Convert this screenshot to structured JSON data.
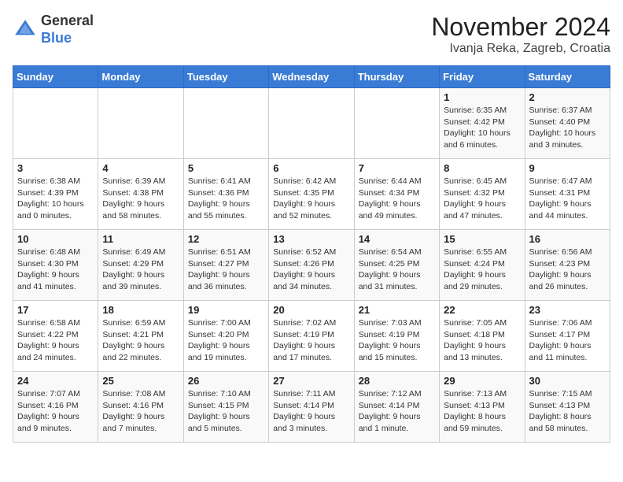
{
  "header": {
    "logo_general": "General",
    "logo_blue": "Blue",
    "month_title": "November 2024",
    "location": "Ivanja Reka, Zagreb, Croatia"
  },
  "calendar": {
    "days_of_week": [
      "Sunday",
      "Monday",
      "Tuesday",
      "Wednesday",
      "Thursday",
      "Friday",
      "Saturday"
    ],
    "weeks": [
      [
        {
          "day": "",
          "info": ""
        },
        {
          "day": "",
          "info": ""
        },
        {
          "day": "",
          "info": ""
        },
        {
          "day": "",
          "info": ""
        },
        {
          "day": "",
          "info": ""
        },
        {
          "day": "1",
          "info": "Sunrise: 6:35 AM\nSunset: 4:42 PM\nDaylight: 10 hours and 6 minutes."
        },
        {
          "day": "2",
          "info": "Sunrise: 6:37 AM\nSunset: 4:40 PM\nDaylight: 10 hours and 3 minutes."
        }
      ],
      [
        {
          "day": "3",
          "info": "Sunrise: 6:38 AM\nSunset: 4:39 PM\nDaylight: 10 hours and 0 minutes."
        },
        {
          "day": "4",
          "info": "Sunrise: 6:39 AM\nSunset: 4:38 PM\nDaylight: 9 hours and 58 minutes."
        },
        {
          "day": "5",
          "info": "Sunrise: 6:41 AM\nSunset: 4:36 PM\nDaylight: 9 hours and 55 minutes."
        },
        {
          "day": "6",
          "info": "Sunrise: 6:42 AM\nSunset: 4:35 PM\nDaylight: 9 hours and 52 minutes."
        },
        {
          "day": "7",
          "info": "Sunrise: 6:44 AM\nSunset: 4:34 PM\nDaylight: 9 hours and 49 minutes."
        },
        {
          "day": "8",
          "info": "Sunrise: 6:45 AM\nSunset: 4:32 PM\nDaylight: 9 hours and 47 minutes."
        },
        {
          "day": "9",
          "info": "Sunrise: 6:47 AM\nSunset: 4:31 PM\nDaylight: 9 hours and 44 minutes."
        }
      ],
      [
        {
          "day": "10",
          "info": "Sunrise: 6:48 AM\nSunset: 4:30 PM\nDaylight: 9 hours and 41 minutes."
        },
        {
          "day": "11",
          "info": "Sunrise: 6:49 AM\nSunset: 4:29 PM\nDaylight: 9 hours and 39 minutes."
        },
        {
          "day": "12",
          "info": "Sunrise: 6:51 AM\nSunset: 4:27 PM\nDaylight: 9 hours and 36 minutes."
        },
        {
          "day": "13",
          "info": "Sunrise: 6:52 AM\nSunset: 4:26 PM\nDaylight: 9 hours and 34 minutes."
        },
        {
          "day": "14",
          "info": "Sunrise: 6:54 AM\nSunset: 4:25 PM\nDaylight: 9 hours and 31 minutes."
        },
        {
          "day": "15",
          "info": "Sunrise: 6:55 AM\nSunset: 4:24 PM\nDaylight: 9 hours and 29 minutes."
        },
        {
          "day": "16",
          "info": "Sunrise: 6:56 AM\nSunset: 4:23 PM\nDaylight: 9 hours and 26 minutes."
        }
      ],
      [
        {
          "day": "17",
          "info": "Sunrise: 6:58 AM\nSunset: 4:22 PM\nDaylight: 9 hours and 24 minutes."
        },
        {
          "day": "18",
          "info": "Sunrise: 6:59 AM\nSunset: 4:21 PM\nDaylight: 9 hours and 22 minutes."
        },
        {
          "day": "19",
          "info": "Sunrise: 7:00 AM\nSunset: 4:20 PM\nDaylight: 9 hours and 19 minutes."
        },
        {
          "day": "20",
          "info": "Sunrise: 7:02 AM\nSunset: 4:19 PM\nDaylight: 9 hours and 17 minutes."
        },
        {
          "day": "21",
          "info": "Sunrise: 7:03 AM\nSunset: 4:19 PM\nDaylight: 9 hours and 15 minutes."
        },
        {
          "day": "22",
          "info": "Sunrise: 7:05 AM\nSunset: 4:18 PM\nDaylight: 9 hours and 13 minutes."
        },
        {
          "day": "23",
          "info": "Sunrise: 7:06 AM\nSunset: 4:17 PM\nDaylight: 9 hours and 11 minutes."
        }
      ],
      [
        {
          "day": "24",
          "info": "Sunrise: 7:07 AM\nSunset: 4:16 PM\nDaylight: 9 hours and 9 minutes."
        },
        {
          "day": "25",
          "info": "Sunrise: 7:08 AM\nSunset: 4:16 PM\nDaylight: 9 hours and 7 minutes."
        },
        {
          "day": "26",
          "info": "Sunrise: 7:10 AM\nSunset: 4:15 PM\nDaylight: 9 hours and 5 minutes."
        },
        {
          "day": "27",
          "info": "Sunrise: 7:11 AM\nSunset: 4:14 PM\nDaylight: 9 hours and 3 minutes."
        },
        {
          "day": "28",
          "info": "Sunrise: 7:12 AM\nSunset: 4:14 PM\nDaylight: 9 hours and 1 minute."
        },
        {
          "day": "29",
          "info": "Sunrise: 7:13 AM\nSunset: 4:13 PM\nDaylight: 8 hours and 59 minutes."
        },
        {
          "day": "30",
          "info": "Sunrise: 7:15 AM\nSunset: 4:13 PM\nDaylight: 8 hours and 58 minutes."
        }
      ]
    ]
  }
}
